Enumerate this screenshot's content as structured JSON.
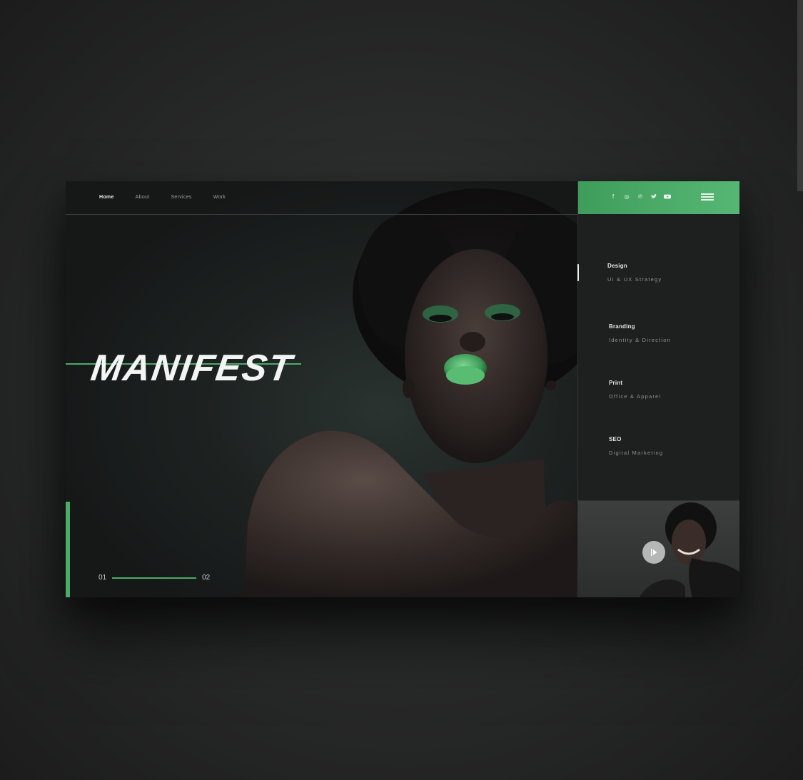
{
  "nav": {
    "items": [
      {
        "label": "Home",
        "active": true
      },
      {
        "label": "About",
        "active": false
      },
      {
        "label": "Services",
        "active": false
      },
      {
        "label": "Work",
        "active": false
      }
    ]
  },
  "hero": {
    "brand": "MANIFEST",
    "slider": {
      "current": "01",
      "next": "02"
    }
  },
  "social": [
    {
      "icon": "facebook-icon",
      "glyph": "f"
    },
    {
      "icon": "instagram-icon",
      "glyph": "◎"
    },
    {
      "icon": "pinterest-icon",
      "glyph": "℗"
    },
    {
      "icon": "twitter-icon",
      "glyph": "🐦"
    },
    {
      "icon": "youtube-icon",
      "glyph": "▶"
    }
  ],
  "services": [
    {
      "title": "Design",
      "subtitle": "UI & UX Strategy"
    },
    {
      "title": "Branding",
      "subtitle": "Identity & Direction"
    },
    {
      "title": "Print",
      "subtitle": "Office & Apparel"
    },
    {
      "title": "SEO",
      "subtitle": "Digital Marketing"
    }
  ],
  "colors": {
    "accent": "#4cab68",
    "background": "#1a1b1b",
    "text": "#e8ece9"
  }
}
